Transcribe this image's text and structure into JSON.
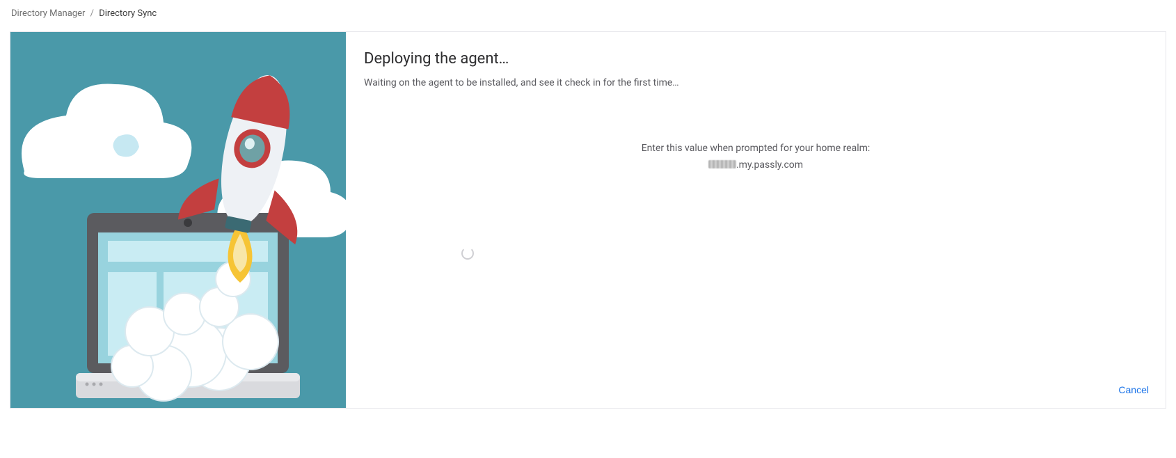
{
  "breadcrumb": {
    "parent": "Directory Manager",
    "separator": "/",
    "current": "Directory Sync"
  },
  "panel": {
    "title": "Deploying the agent…",
    "subtitle": "Waiting on the agent to be installed, and see it check in for the first time…",
    "realm_prompt": "Enter this value when prompted for your home realm:",
    "realm_value_suffix": ".my.passly.com",
    "cancel_label": "Cancel"
  },
  "illustration": {
    "name": "rocket-laptop-illustration"
  }
}
